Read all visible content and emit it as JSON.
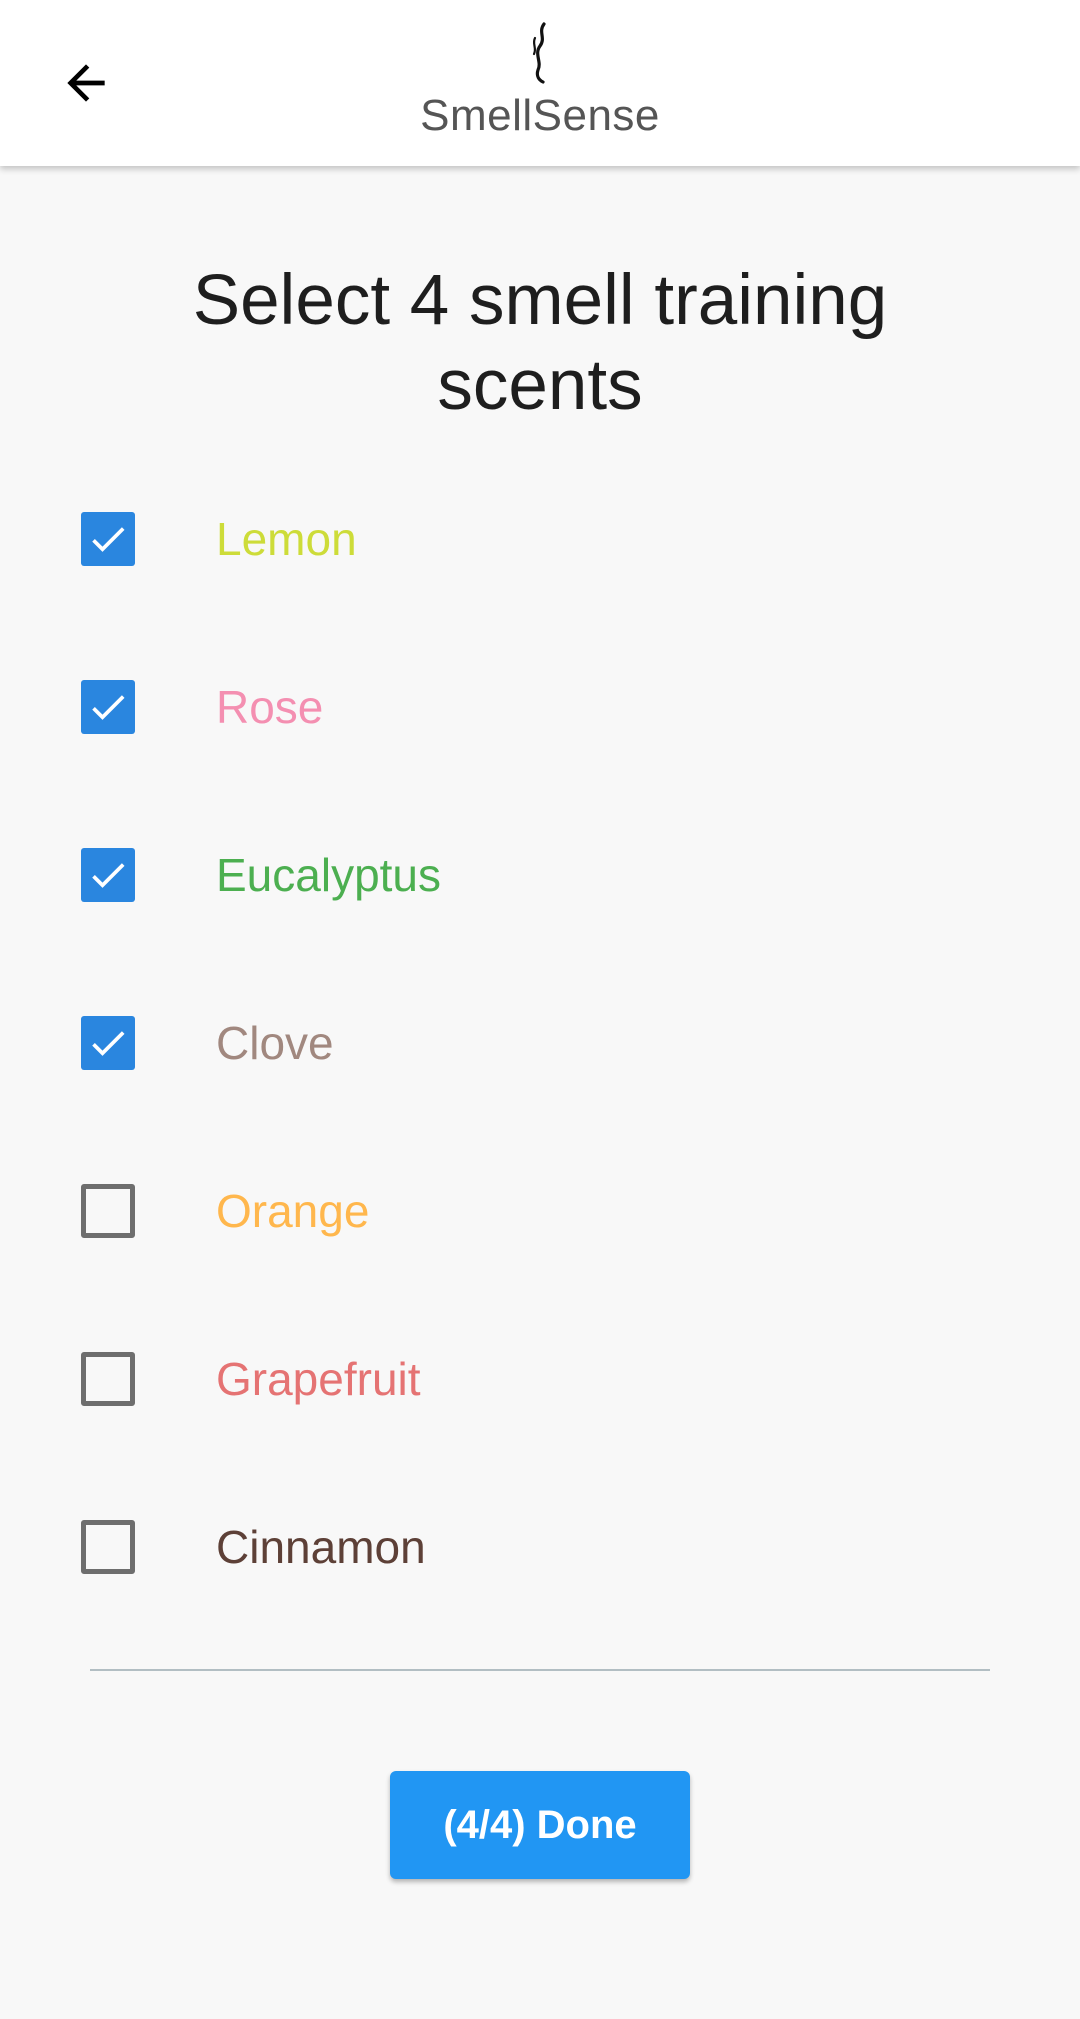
{
  "app": {
    "title": "SmellSense",
    "back_icon": "arrow-left-icon",
    "logo_icon": "smoke-wisp-icon"
  },
  "page": {
    "heading": "Select 4 smell training scents"
  },
  "scents": [
    {
      "label": "Lemon",
      "checked": true,
      "color": "#cddc39"
    },
    {
      "label": "Rose",
      "checked": true,
      "color": "#f48fb1"
    },
    {
      "label": "Eucalyptus",
      "checked": true,
      "color": "#4caf50"
    },
    {
      "label": "Clove",
      "checked": true,
      "color": "#a1887f"
    },
    {
      "label": "Orange",
      "checked": false,
      "color": "#ffb74d"
    },
    {
      "label": "Grapefruit",
      "checked": false,
      "color": "#e57373"
    },
    {
      "label": "Cinnamon",
      "checked": false,
      "color": "#5d4037"
    }
  ],
  "done_button": {
    "label": "(4/4) Done",
    "color": "#2196f3"
  },
  "colors": {
    "checkbox_checked": "#2a86df",
    "checkbox_unchecked_border": "#6e6e6e",
    "background": "#f8f8f8"
  }
}
